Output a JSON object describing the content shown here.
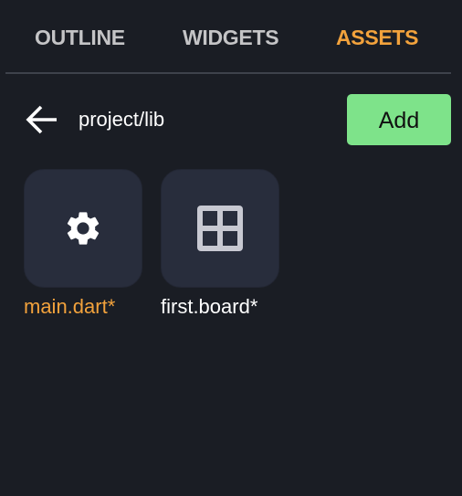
{
  "tabs": [
    {
      "label": "OUTLINE",
      "active": false
    },
    {
      "label": "WIDGETS",
      "active": false
    },
    {
      "label": "ASSETS",
      "active": true
    }
  ],
  "toolbar": {
    "back_icon": "arrow-left-icon",
    "path": "project/lib",
    "add_label": "Add"
  },
  "assets": [
    {
      "name": "main.dart*",
      "icon": "gear-icon",
      "selected": true
    },
    {
      "name": "first.board*",
      "icon": "grid-icon",
      "selected": false
    }
  ],
  "colors": {
    "background": "#1a1d24",
    "accent": "#f2a23c",
    "add_button": "#7ee38a",
    "tile": "#282d3c"
  }
}
